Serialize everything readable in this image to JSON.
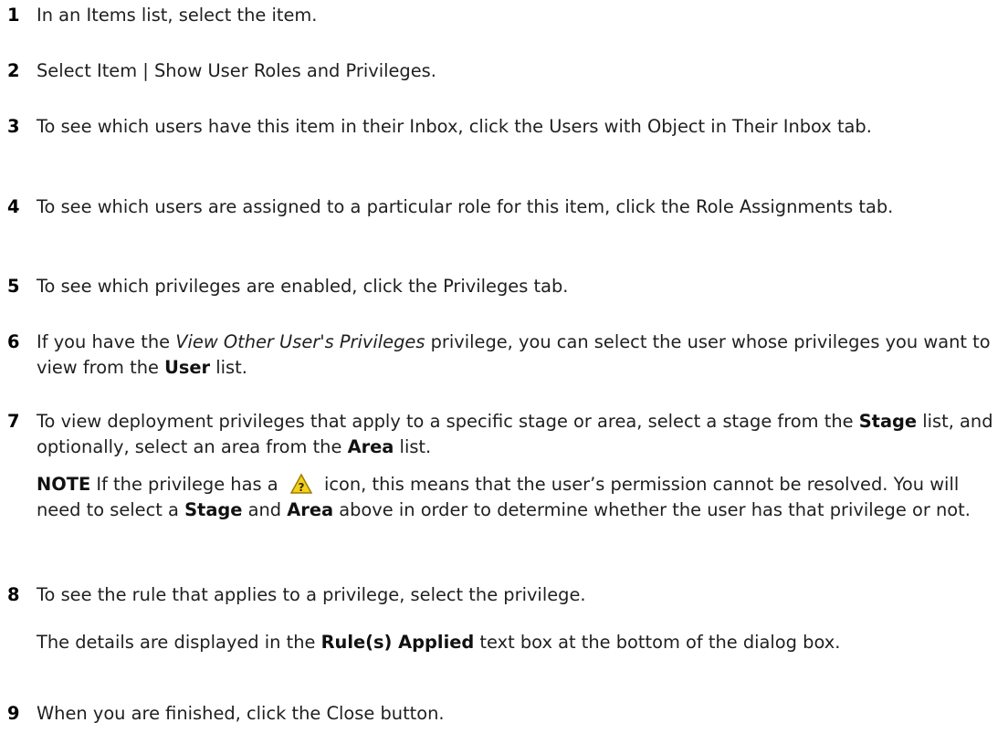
{
  "steps": [
    {
      "num": "1",
      "text": "In an Items list, select the item."
    },
    {
      "num": "2",
      "text": "Select Item | Show User Roles and Privileges."
    },
    {
      "num": "3",
      "text": "To see which users have this item in their Inbox, click the Users with Object in Their Inbox tab."
    },
    {
      "num": "4",
      "text": "To see which users are assigned to a particular role for this item, click the Role Assignments tab."
    },
    {
      "num": "5",
      "text": "To see which privileges are enabled, click the Privileges tab."
    },
    {
      "num": "6",
      "t1": "If you have the ",
      "i1": "View Other User's Privileges",
      "t2": " privilege, you can select the user whose privileges you want to view from the ",
      "b1": "User",
      "t3": " list."
    },
    {
      "num": "7",
      "t1": "To view deployment privileges that apply to a specific stage or area, select a stage from the ",
      "b1": "Stage",
      "t2": " list, and optionally, select an area from the ",
      "b2": "Area",
      "t3": " list."
    },
    {
      "num": "8",
      "text": "To see the rule that applies to a privilege, select the privilege."
    },
    {
      "num": "9",
      "text": "When you are finished, click the Close button."
    }
  ],
  "note": {
    "label": "NOTE",
    "t1": " If the privilege has a ",
    "icon": "warning-question-icon",
    "t2": " icon, this means that the user’s permission cannot be resolved. You will need to select a ",
    "b1": "Stage",
    "t3": " and ",
    "b2": "Area",
    "t4": " above in order to determine whether the user has that privilege or not."
  },
  "details": {
    "t1": "The details are displayed in the ",
    "b1": "Rule(s) Applied",
    "t2": " text box at the bottom of the dialog box."
  },
  "colors": {
    "icon_fill": "#f2d21b",
    "icon_border": "#a07a00"
  }
}
